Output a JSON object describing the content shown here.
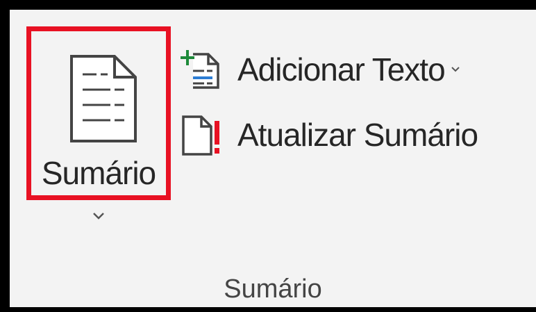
{
  "ribbon_group": {
    "label": "Sumário",
    "toc_button": {
      "label": "Sumário",
      "icon": "document-lines-icon",
      "highlight_color": "#e81123"
    },
    "add_text_button": {
      "label": "Adicionar Texto",
      "icon": "add-text-icon",
      "has_dropdown": true
    },
    "update_toc_button": {
      "label": "Atualizar Sumário",
      "icon": "update-document-icon"
    }
  },
  "colors": {
    "frame": "#000000",
    "ribbon_background": "#f3f3f3",
    "text": "#262626",
    "add_plus": "#1e8a3a",
    "add_line_blue": "#2b7cd3",
    "update_exclaim": "#e81123"
  }
}
